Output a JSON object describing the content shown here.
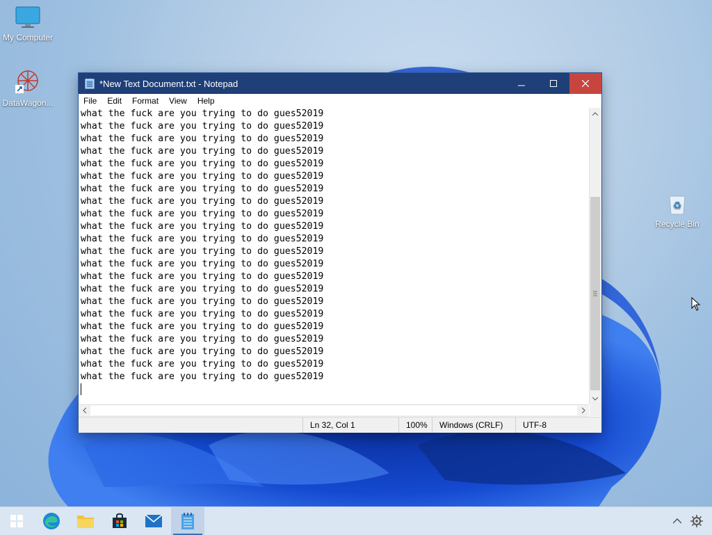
{
  "desktop": {
    "icons": [
      {
        "label": "My Computer",
        "icon": "monitor-icon"
      },
      {
        "label": "DataWagon...",
        "icon": "datawagon-icon"
      },
      {
        "label": "Recycle Bin",
        "icon": "recycle-bin-icon"
      }
    ]
  },
  "notepad": {
    "title": "*New Text Document.txt - Notepad",
    "menu": [
      "File",
      "Edit",
      "Format",
      "View",
      "Help"
    ],
    "lines": [
      "what the fuck are you trying to do gues52019",
      "what the fuck are you trying to do gues52019",
      "what the fuck are you trying to do gues52019",
      "what the fuck are you trying to do gues52019",
      "what the fuck are you trying to do gues52019",
      "what the fuck are you trying to do gues52019",
      "what the fuck are you trying to do gues52019",
      "what the fuck are you trying to do gues52019",
      "what the fuck are you trying to do gues52019",
      "what the fuck are you trying to do gues52019",
      "what the fuck are you trying to do gues52019",
      "what the fuck are you trying to do gues52019",
      "what the fuck are you trying to do gues52019",
      "what the fuck are you trying to do gues52019",
      "what the fuck are you trying to do gues52019",
      "what the fuck are you trying to do gues52019",
      "what the fuck are you trying to do gues52019",
      "what the fuck are you trying to do gues52019",
      "what the fuck are you trying to do gues52019",
      "what the fuck are you trying to do gues52019",
      "what the fuck are you trying to do gues52019",
      "what the fuck are you trying to do gues52019",
      ""
    ],
    "status": {
      "position": "Ln 32, Col 1",
      "zoom": "100%",
      "line_ending": "Windows (CRLF)",
      "encoding": "UTF-8"
    }
  },
  "taskbar": {
    "items": [
      {
        "icon": "windows-start-icon"
      },
      {
        "icon": "edge-browser-icon"
      },
      {
        "icon": "file-explorer-icon"
      },
      {
        "icon": "store-icon"
      },
      {
        "icon": "mail-icon"
      },
      {
        "icon": "notepad-icon",
        "active": true
      }
    ],
    "tray": [
      {
        "icon": "chevron-up-icon"
      },
      {
        "icon": "gear-icon"
      }
    ]
  },
  "colors": {
    "titlebar": "#1f3f78",
    "close": "#c8453f",
    "taskbar": "#dbe6f3"
  }
}
